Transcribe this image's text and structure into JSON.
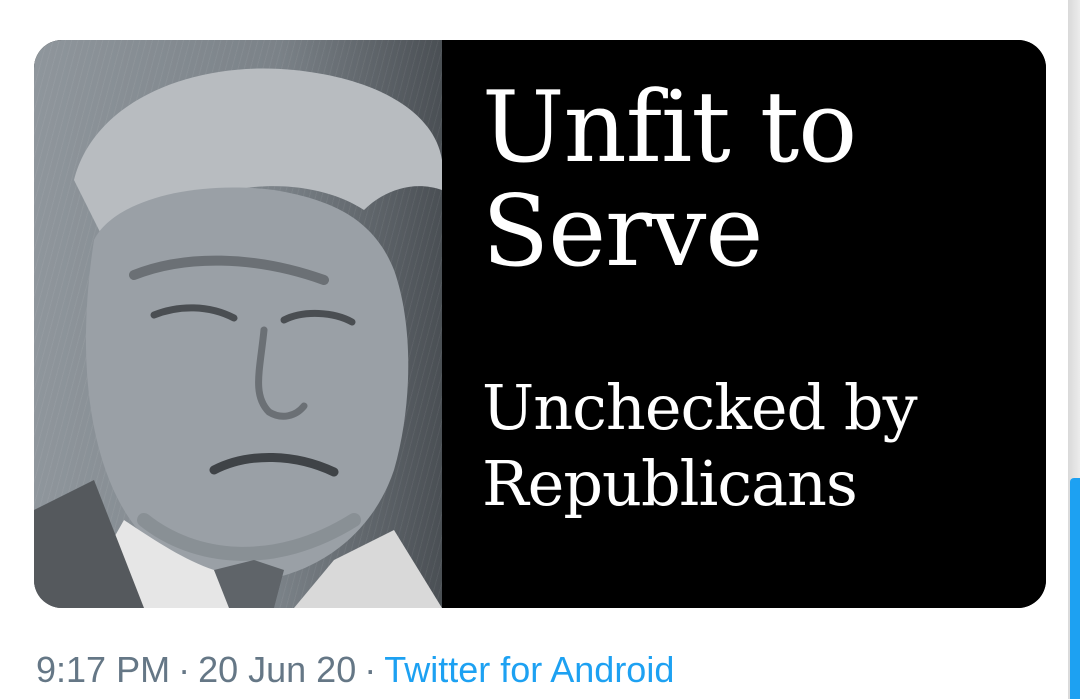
{
  "media": {
    "headline_line1": "Unfit to",
    "headline_line2": "Serve",
    "subhead_line1": "Unchecked by",
    "subhead_line2": "Republicans"
  },
  "tweet_meta": {
    "time": "9:17 PM",
    "separator": "·",
    "date": "20 Jun 20",
    "source": "Twitter for Android"
  },
  "colors": {
    "meta_text": "#657786",
    "link": "#1da1f2",
    "card_background": "#000000",
    "card_text": "#ffffff"
  }
}
